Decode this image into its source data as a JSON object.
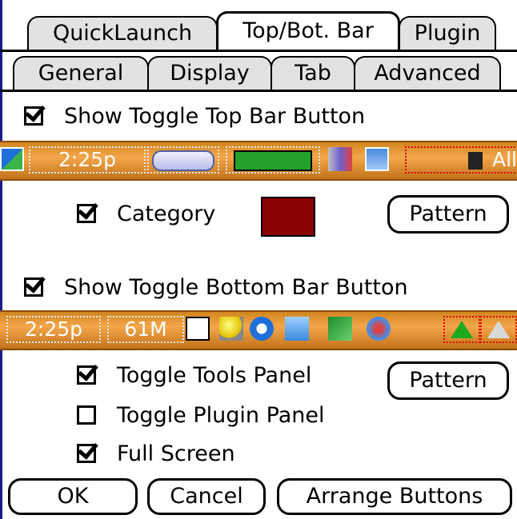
{
  "tabs_row1": [
    "QuickLaunch",
    "Top/Bot. Bar",
    "Plugin"
  ],
  "tabs_row2": [
    "General",
    "Display",
    "Tab",
    "Advanced"
  ],
  "active_tab": "Top/Bot. Bar",
  "top_section": {
    "toggle_label": "Show Toggle Top Bar Button",
    "toggle_checked": true,
    "bar": {
      "time": "2:25p",
      "category_text": "All"
    },
    "category": {
      "label": "Category",
      "checked": true,
      "color": "#8b0000"
    },
    "pattern_button": "Pattern"
  },
  "bottom_section": {
    "toggle_label": "Show Toggle Bottom Bar Button",
    "toggle_checked": true,
    "bar": {
      "time": "2:25p",
      "memory": "61M"
    },
    "options": [
      {
        "label": "Toggle Tools Panel",
        "checked": true
      },
      {
        "label": "Toggle Plugin Panel",
        "checked": false
      },
      {
        "label": "Full Screen",
        "checked": true
      }
    ],
    "pattern_button": "Pattern"
  },
  "buttons": {
    "ok": "OK",
    "cancel": "Cancel",
    "arrange": "Arrange Buttons"
  },
  "colors": {
    "bar_orange": "#e8952e",
    "dotted_red": "#e00000",
    "swatch_green": "#22a22a"
  }
}
